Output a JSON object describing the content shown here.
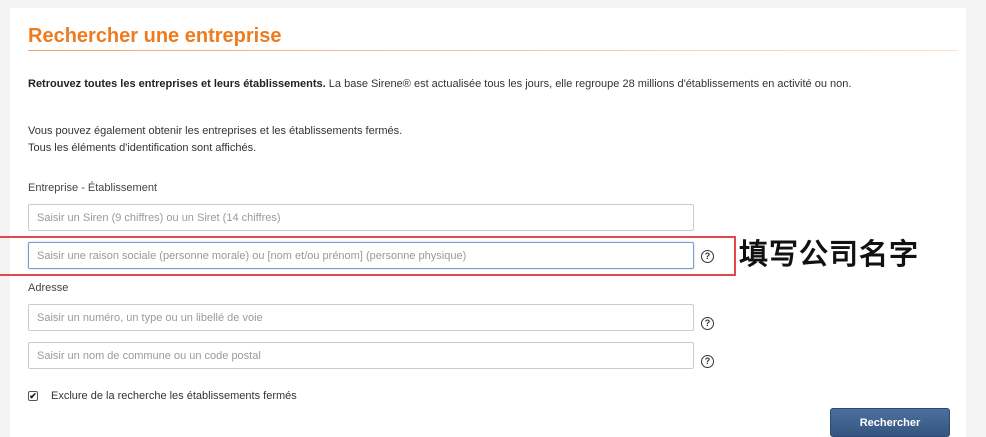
{
  "page": {
    "title": "Rechercher une entreprise"
  },
  "intro": {
    "bold": "Retrouvez toutes les entreprises et leurs établissements.",
    "rest": " La base Sirene® est actualisée tous les jours, elle regroupe 28 millions d'établissements en activité ou non."
  },
  "info": {
    "line1": "Vous pouvez également obtenir les entreprises et les établissements fermés.",
    "line2": "Tous les éléments d'identification sont affichés."
  },
  "entreprise_section": {
    "label": "Entreprise - Établissement",
    "siren_placeholder": "Saisir un Siren (9 chiffres) ou un Siret (14 chiffres)",
    "name_placeholder": "Saisir une raison sociale (personne morale) ou [nom et/ou prénom] (personne physique)"
  },
  "adresse_section": {
    "label": "Adresse",
    "street_placeholder": "Saisir un numéro, un type ou un libellé de voie",
    "commune_placeholder": "Saisir un nom de commune ou un code postal"
  },
  "help": {
    "glyph": "?"
  },
  "annotation": {
    "text": "填写公司名字",
    "box_color": "#e24a4a"
  },
  "options": {
    "exclude_closed_label": "Exclure de la recherche les établissements fermés",
    "exclude_closed_checked": true,
    "check_glyph": "✔"
  },
  "actions": {
    "search_label": "Rechercher"
  },
  "colors": {
    "title": "#ef7b1f",
    "button": "#3d5f8c"
  }
}
